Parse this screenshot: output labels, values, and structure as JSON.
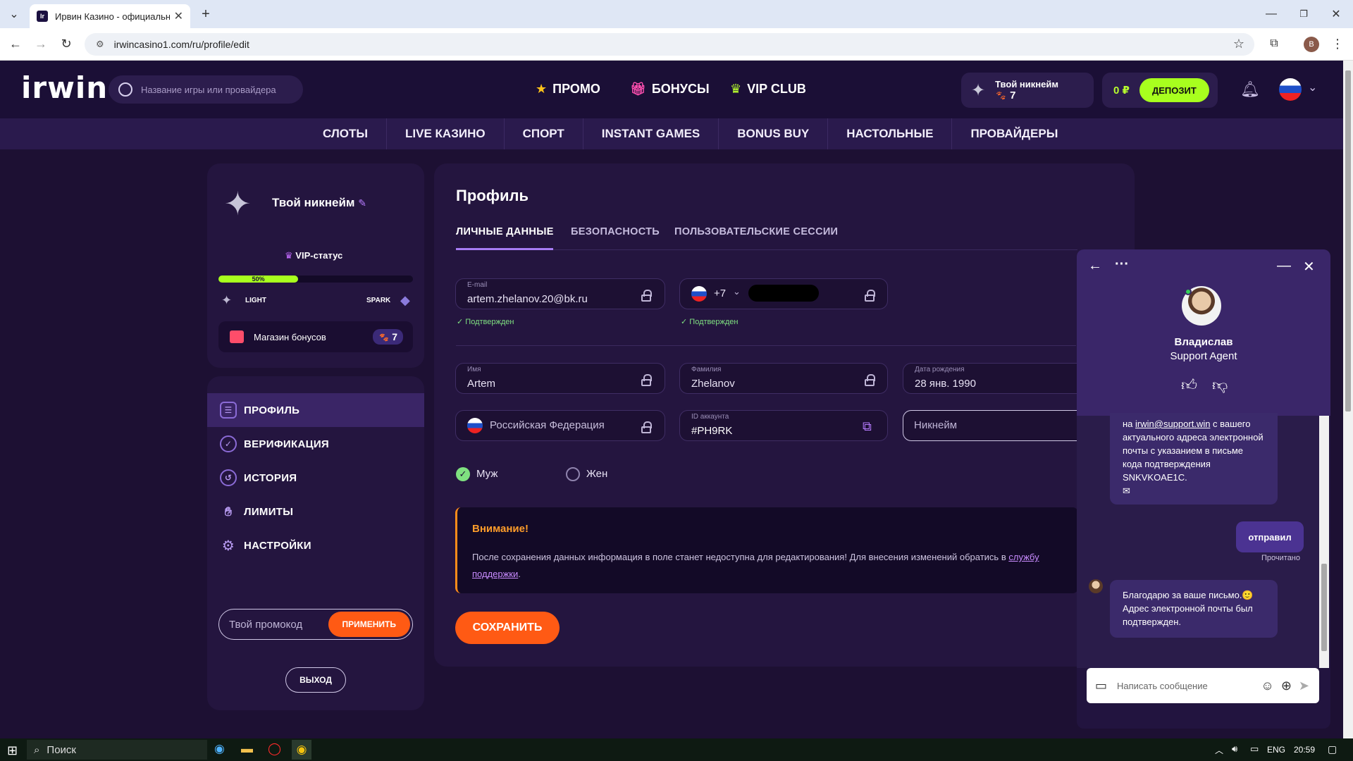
{
  "browser": {
    "tab_title": "Ирвин Казино - официальный",
    "favicon_text": "Ir",
    "url": "irwincasino1.com/ru/profile/edit",
    "profile_initial": "B"
  },
  "header": {
    "logo": "irwin",
    "search_placeholder": "Название игры или провайдера",
    "nav": [
      {
        "label": "ПРОМО",
        "icon": "star-icon"
      },
      {
        "label": "БОНУСЫ",
        "icon": "gift-icon"
      },
      {
        "label": "VIP CLUB",
        "icon": "crown-icon"
      }
    ],
    "user": {
      "nickname": "Твой никнейм",
      "paws": "7"
    },
    "balance": "0 ₽",
    "deposit_label": "ДЕПОЗИТ"
  },
  "categories": [
    "СЛОТЫ",
    "LIVE КАЗИНО",
    "СПОРТ",
    "INSTANT GAMES",
    "BONUS BUY",
    "НАСТОЛЬНЫЕ",
    "ПРОВАЙДЕРЫ"
  ],
  "sidebar": {
    "nickname": "Твой никнейм",
    "vip_label": "VIP-статус",
    "progress_label": "50%",
    "progress_fraction": 0.41,
    "level_left": "LIGHT",
    "level_right": "SPARK",
    "shop_label": "Магазин бонусов",
    "shop_count": "7",
    "menu": [
      {
        "label": "ПРОФИЛЬ",
        "icon": "id-card-icon",
        "active": true
      },
      {
        "label": "ВЕРИФИКАЦИЯ",
        "icon": "verified-badge-icon"
      },
      {
        "label": "ИСТОРИЯ",
        "icon": "history-icon"
      },
      {
        "label": "ЛИМИТЫ",
        "icon": "hand-icon"
      },
      {
        "label": "НАСТРОЙКИ",
        "icon": "gear-icon"
      }
    ],
    "promo_placeholder": "Твой промокод",
    "promo_apply": "ПРИМЕНИТЬ",
    "logout": "ВЫХОД"
  },
  "profile": {
    "title": "Профиль",
    "tabs": [
      "ЛИЧНЫЕ ДАННЫЕ",
      "БЕЗОПАСНОСТЬ",
      "ПОЛЬЗОВАТЕЛЬСКИЕ СЕССИИ"
    ],
    "email_label": "E-mail",
    "email_value": "artem.zhelanov.20@bk.ru",
    "phone_code": "+7",
    "verified": "Подтвержден",
    "first_name_label": "Имя",
    "first_name": "Artem",
    "last_name_label": "Фамилия",
    "last_name": "Zhelanov",
    "birth_label": "Дата рождения",
    "birth_value": "28 янв. 1990",
    "country": "Российская Федерация",
    "account_id_label": "ID аккаунта",
    "account_id": "#PH9RK",
    "nickname_placeholder": "Никнейм",
    "gender_male": "Муж",
    "gender_female": "Жен",
    "warning_title": "Внимание!",
    "warning_text": "После сохранения данных информация в поле станет недоступна для редактирования! Для внесения изменений обратись в",
    "warning_link": "службу поддержки",
    "save": "СОХРАНИТЬ"
  },
  "chat": {
    "agent_name": "Владислав",
    "agent_role": "Support Agent",
    "msg1_pre": "на ",
    "msg1_link": "irwin@support.win",
    "msg1_post": " с вашего актуального адреса электронной почты с указанием в письме кода подтверждения SNKVKOAE1C.",
    "msg2": "отправил",
    "read": "Прочитано",
    "msg3": "Благодарю за ваше письмо.🙂 Адрес электронной почты был подтвержден.",
    "compose_placeholder": "Написать сообщение"
  },
  "taskbar": {
    "search": "Поиск",
    "lang": "ENG",
    "time": "20:59"
  }
}
